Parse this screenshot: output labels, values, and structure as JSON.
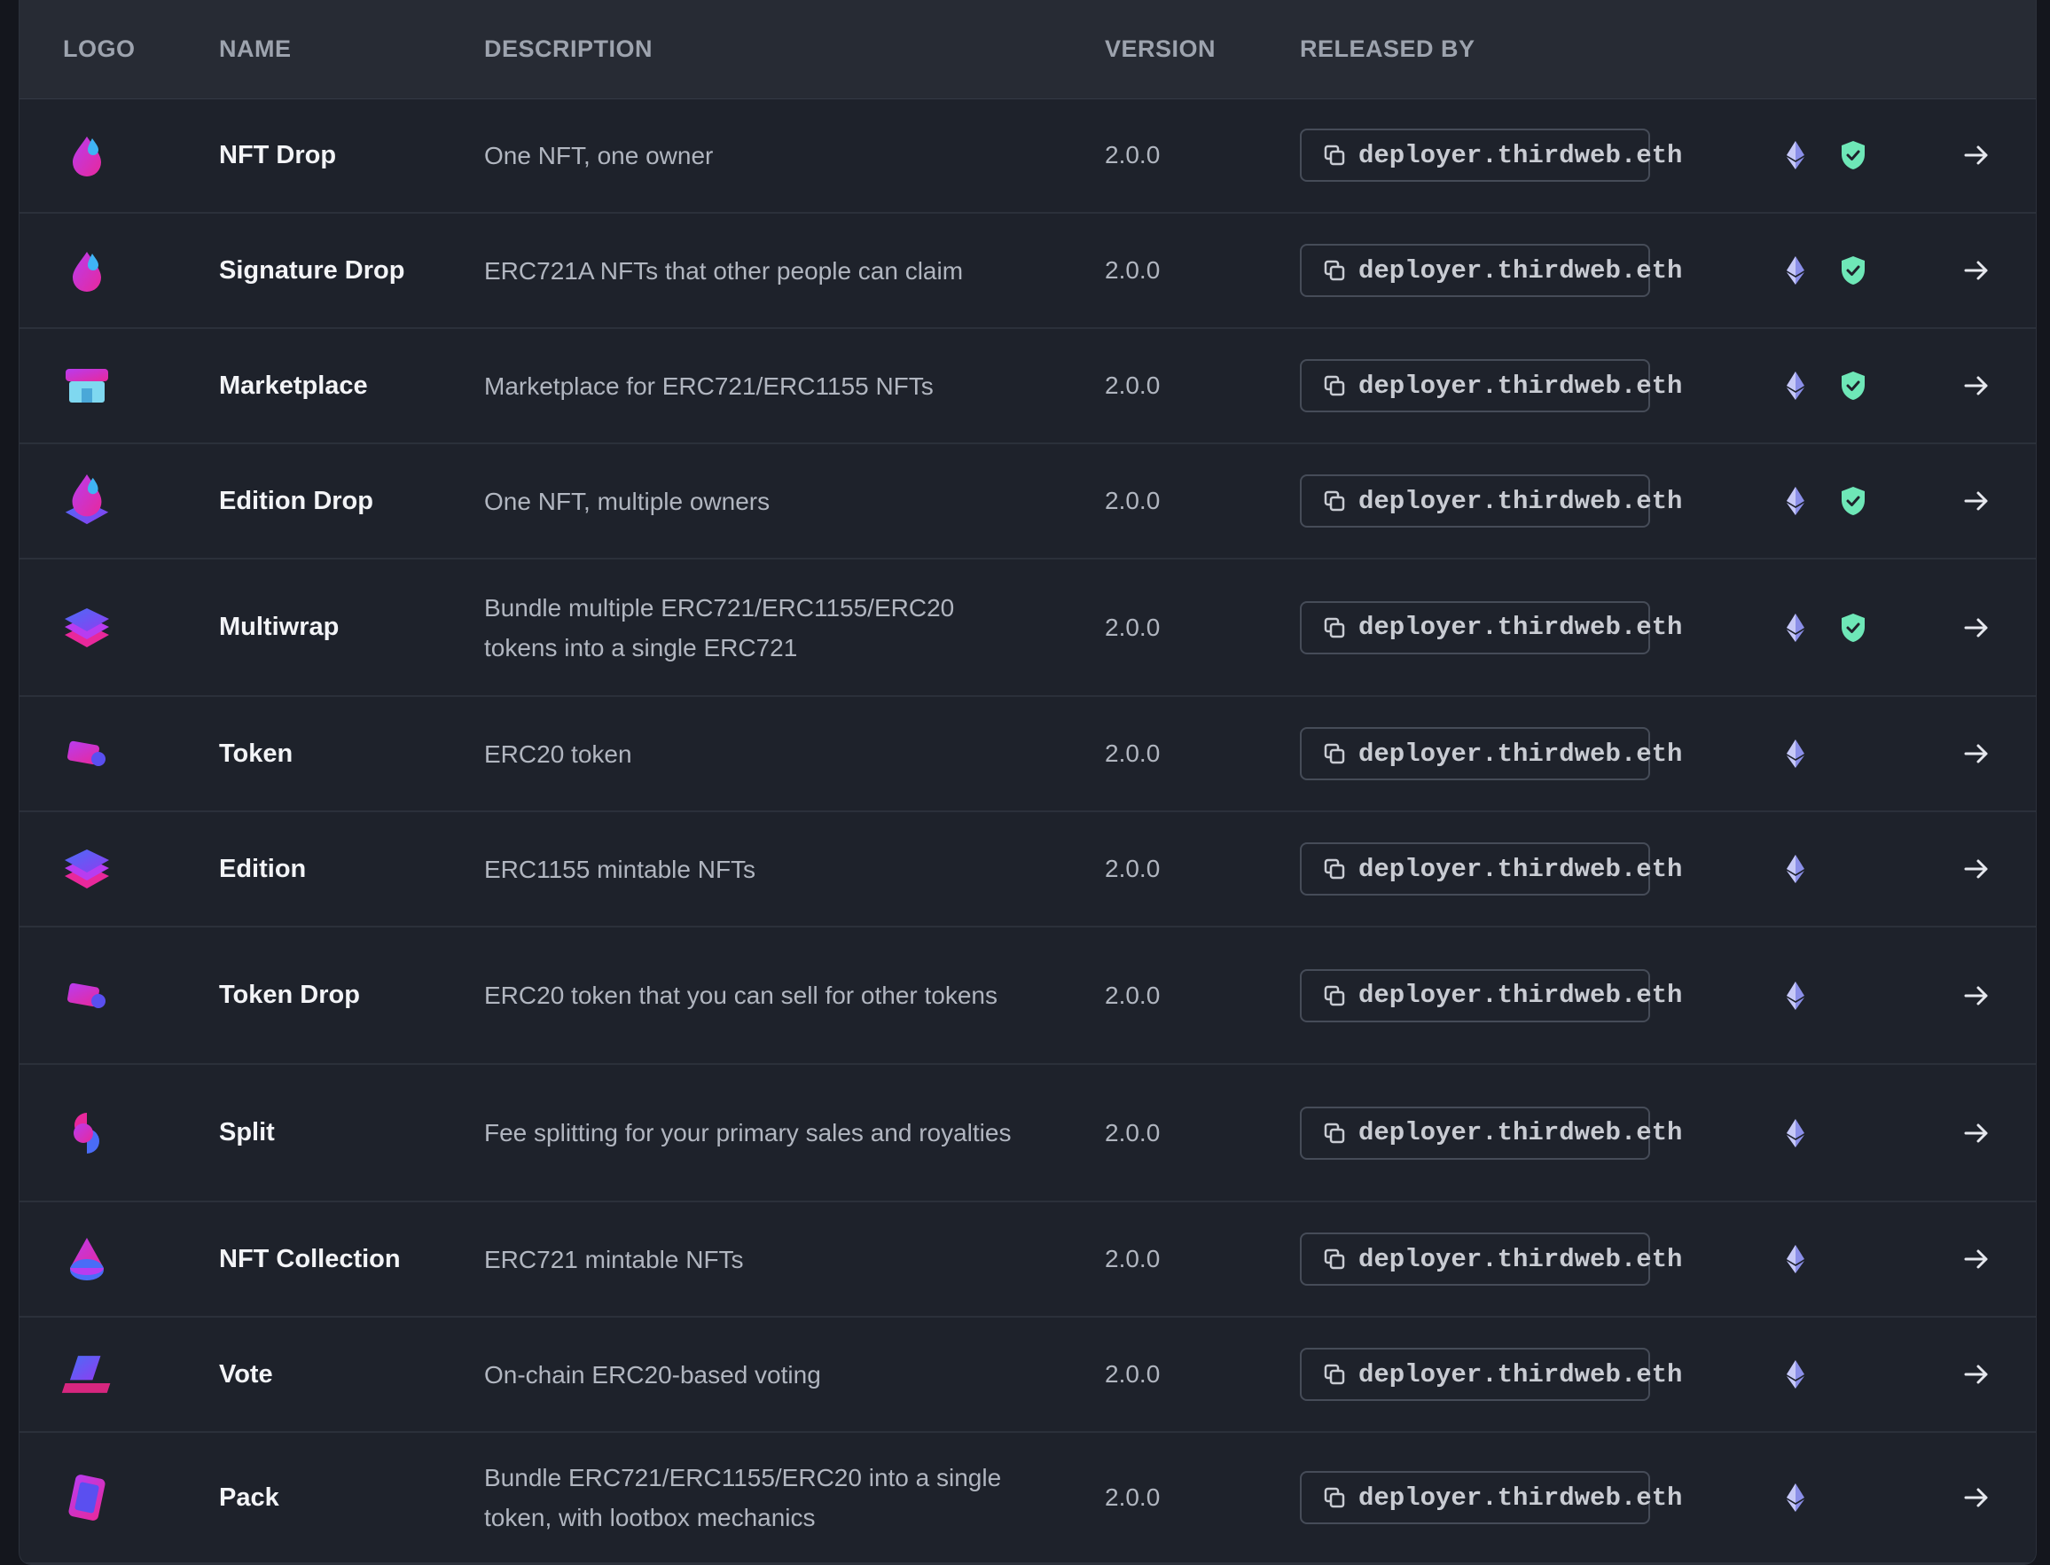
{
  "table": {
    "headers": {
      "logo": "LOGO",
      "name": "NAME",
      "description": "DESCRIPTION",
      "version": "VERSION",
      "released_by": "RELEASED BY"
    },
    "rows": [
      {
        "name": "NFT Drop",
        "description": "One NFT, one owner",
        "version": "2.0.0",
        "released_by": "deployer.thirdweb.eth",
        "logo_icon": "drop-logo-icon",
        "audited": true
      },
      {
        "name": "Signature Drop",
        "description": "ERC721A NFTs that other people can claim",
        "version": "2.0.0",
        "released_by": "deployer.thirdweb.eth",
        "logo_icon": "drop-logo-icon",
        "audited": true
      },
      {
        "name": "Marketplace",
        "description": "Marketplace for ERC721/ERC1155 NFTs",
        "version": "2.0.0",
        "released_by": "deployer.thirdweb.eth",
        "logo_icon": "store-logo-icon",
        "audited": true
      },
      {
        "name": "Edition Drop",
        "description": "One NFT, multiple owners",
        "version": "2.0.0",
        "released_by": "deployer.thirdweb.eth",
        "logo_icon": "edition-drop-logo-icon",
        "audited": true
      },
      {
        "name": "Multiwrap",
        "description": "Bundle multiple ERC721/ERC1155/ERC20 tokens into a single ERC721",
        "version": "2.0.0",
        "released_by": "deployer.thirdweb.eth",
        "logo_icon": "layers-logo-icon",
        "audited": true
      },
      {
        "name": "Token",
        "description": "ERC20 token",
        "version": "2.0.0",
        "released_by": "deployer.thirdweb.eth",
        "logo_icon": "card-logo-icon",
        "audited": false
      },
      {
        "name": "Edition",
        "description": "ERC1155 mintable NFTs",
        "version": "2.0.0",
        "released_by": "deployer.thirdweb.eth",
        "logo_icon": "layers-logo-icon",
        "audited": false
      },
      {
        "name": "Token Drop",
        "description": "ERC20 token that you can sell for other tokens",
        "version": "2.0.0",
        "released_by": "deployer.thirdweb.eth",
        "logo_icon": "card-logo-icon",
        "audited": false
      },
      {
        "name": "Split",
        "description": "Fee splitting for your primary sales and royalties",
        "version": "2.0.0",
        "released_by": "deployer.thirdweb.eth",
        "logo_icon": "split-logo-icon",
        "audited": false
      },
      {
        "name": "NFT Collection",
        "description": "ERC721 mintable NFTs",
        "version": "2.0.0",
        "released_by": "deployer.thirdweb.eth",
        "logo_icon": "cone-logo-icon",
        "audited": false
      },
      {
        "name": "Vote",
        "description": "On-chain ERC20-based voting",
        "version": "2.0.0",
        "released_by": "deployer.thirdweb.eth",
        "logo_icon": "vote-logo-icon",
        "audited": false
      },
      {
        "name": "Pack",
        "description": "Bundle ERC721/ERC1155/ERC20 into a single token, with lootbox mechanics",
        "version": "2.0.0",
        "released_by": "deployer.thirdweb.eth",
        "logo_icon": "pack-logo-icon",
        "audited": false
      }
    ]
  },
  "colors": {
    "audit_green": "#6ee7b7",
    "eth_purple": "#8b8fe8",
    "logo_pink": "#e23ad0",
    "logo_blue": "#3b82f6"
  }
}
